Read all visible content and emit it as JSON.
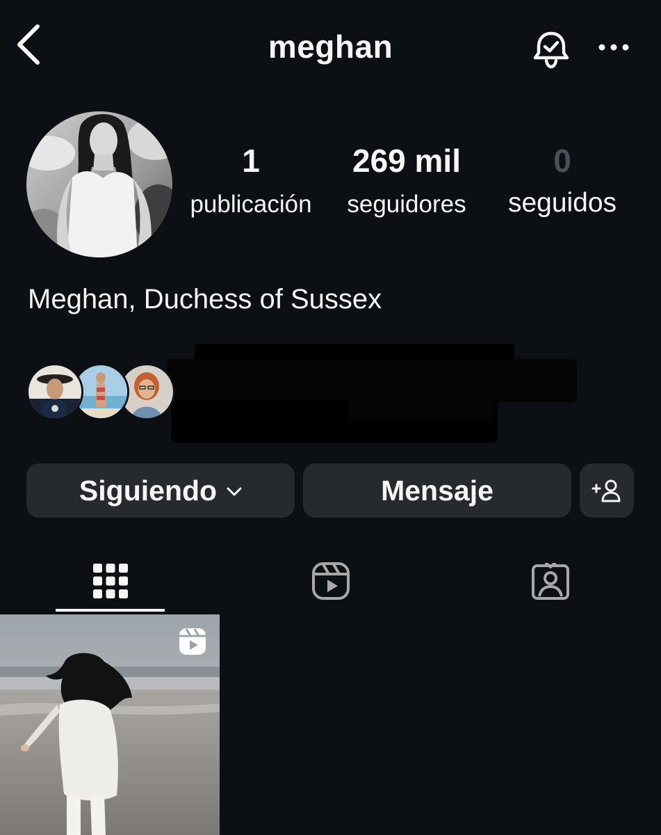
{
  "header": {
    "username": "meghan",
    "back_icon": "chevron-left-icon",
    "bell_icon": "bell-check-icon",
    "more_icon": "more-horizontal-icon"
  },
  "profile": {
    "full_name": "Meghan, Duchess of Sussex",
    "avatar": "profile-photo"
  },
  "stats": {
    "posts": {
      "count": "1",
      "label": "publicación"
    },
    "followers": {
      "count": "269 mil",
      "label": "seguidores"
    },
    "following": {
      "count": "0",
      "label": "seguidos"
    }
  },
  "mutual_followers": {
    "avatars": [
      "mutual-avatar-1",
      "mutual-avatar-2",
      "mutual-avatar-3"
    ]
  },
  "actions": {
    "following_label": "Siguiendo",
    "message_label": "Mensaje",
    "add_user_icon": "add-user-icon"
  },
  "tabs": [
    "grid-icon",
    "reels-icon",
    "tagged-icon"
  ],
  "posts": [
    {
      "type": "reel",
      "badge_icon": "reel-icon"
    }
  ],
  "colors": {
    "background": "#0c1014",
    "button": "#262a2f",
    "text": "#f5f5f5",
    "muted": "#4a4f55"
  }
}
